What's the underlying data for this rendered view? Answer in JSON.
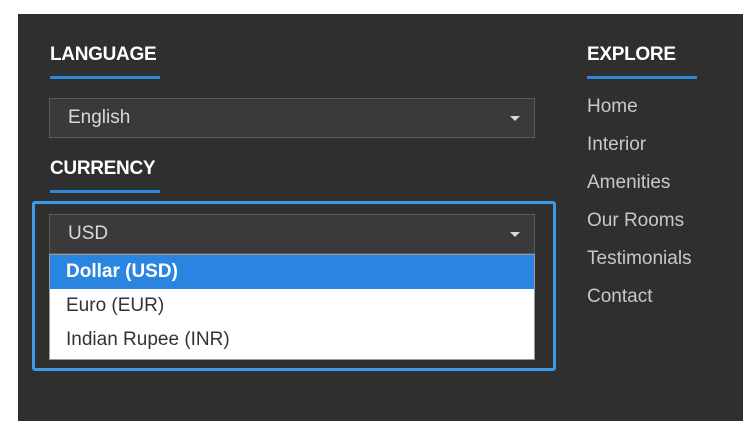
{
  "language": {
    "heading": "LANGUAGE",
    "selected": "English"
  },
  "currency": {
    "heading": "CURRENCY",
    "selected": "USD",
    "options": [
      "Dollar (USD)",
      "Euro (EUR)",
      "Indian Rupee (INR)"
    ],
    "highlighted_index": 0
  },
  "explore": {
    "heading": "EXPLORE",
    "links": [
      "Home",
      "Interior",
      "Amenities",
      "Our Rooms",
      "Testimonials",
      "Contact"
    ]
  },
  "colors": {
    "panel_bg": "#2f2f2f",
    "accent": "#2e86d6",
    "highlight": "#2a85e0"
  }
}
